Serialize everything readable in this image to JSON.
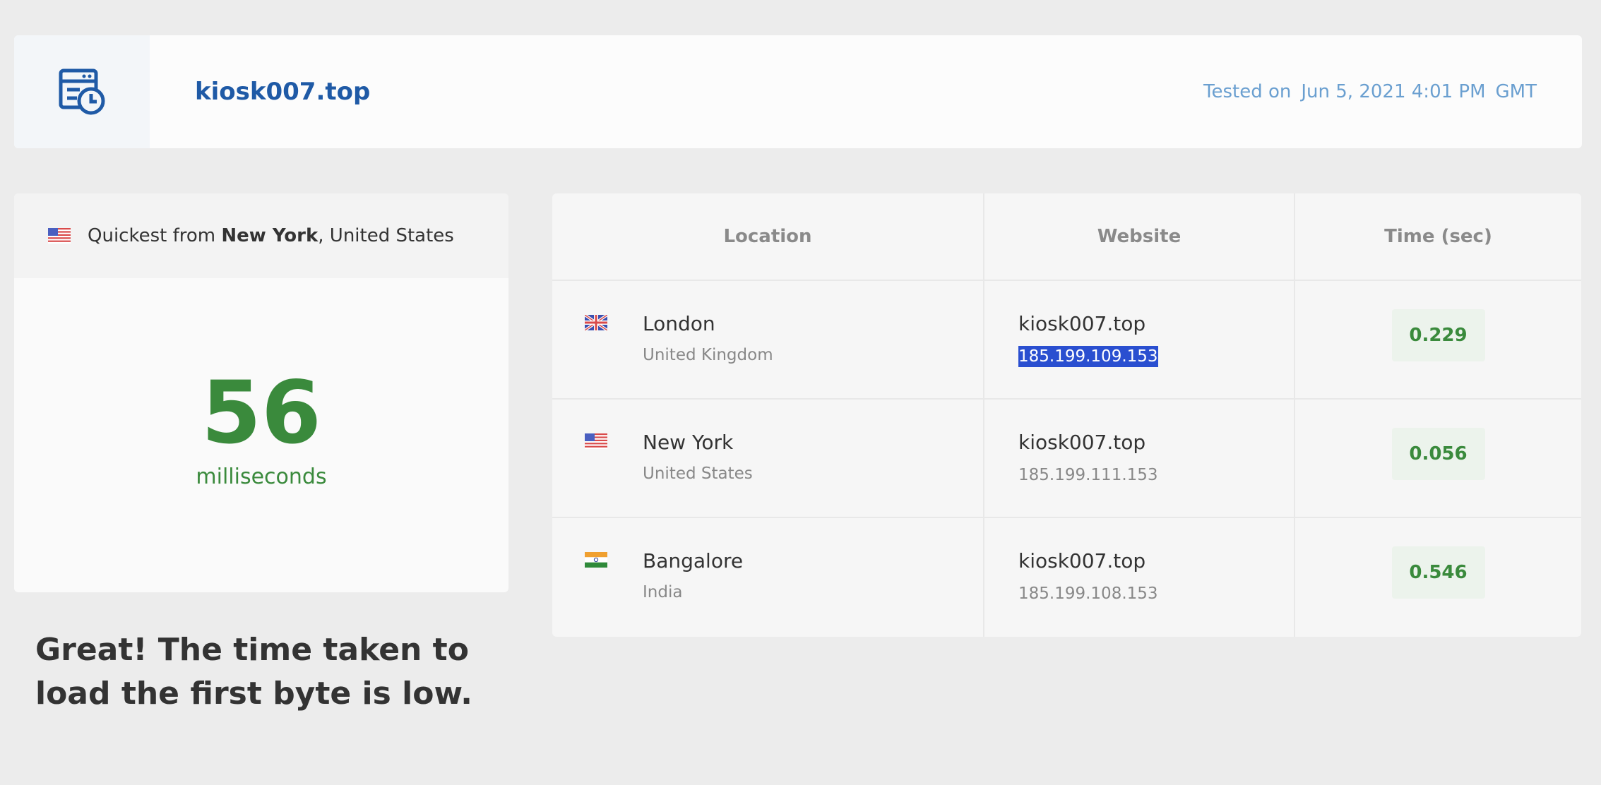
{
  "header": {
    "site": "kiosk007.top",
    "icon": "server-clock-icon",
    "tested_label": "Tested on",
    "tested_datetime": "Jun 5, 2021 4:01 PM",
    "timezone": "GMT"
  },
  "summary": {
    "prefix": "Quickest from",
    "city": "New York",
    "suffix": ", United States",
    "value": "56",
    "unit": "milliseconds",
    "verdict": "Great! The time taken to load the first byte is low."
  },
  "table": {
    "headers": {
      "location": "Location",
      "website": "Website",
      "time": "Time (sec)"
    },
    "rows": [
      {
        "city": "London",
        "country": "United Kingdom",
        "flag": "uk-flag-icon",
        "domain": "kiosk007.top",
        "ip": "185.199.109.153",
        "time": "0.229"
      },
      {
        "city": "New York",
        "country": "United States",
        "flag": "us-flag-icon",
        "domain": "kiosk007.top",
        "ip": "185.199.111.153",
        "time": "0.056"
      },
      {
        "city": "Bangalore",
        "country": "India",
        "flag": "india-flag-icon",
        "domain": "kiosk007.top",
        "ip": "185.199.108.153",
        "time": "0.546"
      }
    ]
  },
  "colors": {
    "brand_blue": "#1f5aa6",
    "good_green": "#3a8a3c",
    "selection": "#2a4fd0"
  }
}
